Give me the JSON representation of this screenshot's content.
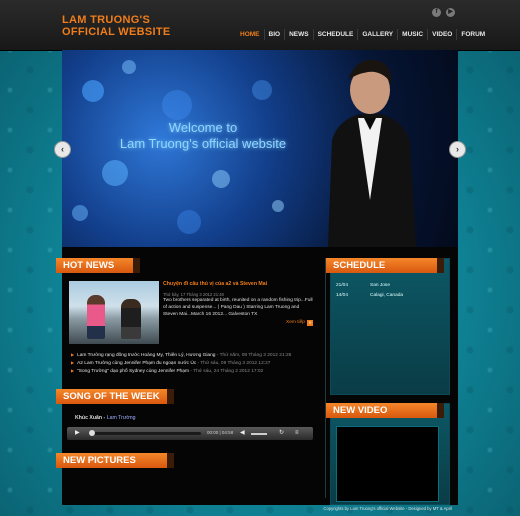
{
  "header": {
    "logo_line1": "LAM TRUONG'S",
    "logo_line2": "OFFICIAL WEBSITE",
    "social_icons": [
      "facebook-icon",
      "youtube-icon"
    ],
    "nav": [
      "HOME",
      "BIO",
      "NEWS",
      "SCHEDULE",
      "GALLERY",
      "MUSIC",
      "VIDEO",
      "FORUM"
    ],
    "active_nav": "HOME",
    "accent_color": "#f07d1a"
  },
  "slider": {
    "welcome_line1": "Welcome to",
    "welcome_line2": "Lam Truong's official website",
    "prev_icon": "chevron-left-icon",
    "next_icon": "chevron-right-icon"
  },
  "hot_news": {
    "title": "HOT NEWS",
    "featured": {
      "headline": "Chuyện đi câu thú vị của a2 và Steven Mai",
      "date": "Thứ bảy, 17 Tháng 3 2012 21:48",
      "body": "Two brothers separated at birth, reunited on a random fishing trip...Full of action and suspense... ( Pang Dau ) Starring Lam Truong and Steven Mai...March 16 2012... Galveston TX",
      "read_more": "Xem tiếp"
    },
    "items": [
      {
        "text": "Lam Trường rạng đông trước Hoàng My, Thiên Lý, Hương Giang",
        "meta": " - Thứ năm, 08 Tháng 3 2012 21:26"
      },
      {
        "text": "A2 Lam Trường cùng Jennifer Phạm đu ngoạn nước Úc",
        "meta": " - Thứ sáu, 09 Tháng 3 2012 12:27"
      },
      {
        "text": "\"Song Trường\" dạo phố Sydney cùng Jennifer Phạm",
        "meta": " - Thứ sáu, 24 Tháng 2 2012 17:02"
      }
    ]
  },
  "song_of_week": {
    "title": "SONG OF THE WEEK",
    "song": "Khúc Xuân",
    "artist": "Lam Trường",
    "time": "00:00 | 04:58"
  },
  "new_pictures": {
    "title": "NEW PICTURES"
  },
  "schedule": {
    "title": "SCHEDULE",
    "rows": [
      {
        "date": "21/04",
        "place": "San Jose"
      },
      {
        "date": "14/04",
        "place": "Calagi, Canada"
      }
    ]
  },
  "new_video": {
    "title": "NEW VIDEO"
  },
  "footer": {
    "text": "Copyrights by Lam Truong's official Website - Designed by MT & April"
  }
}
